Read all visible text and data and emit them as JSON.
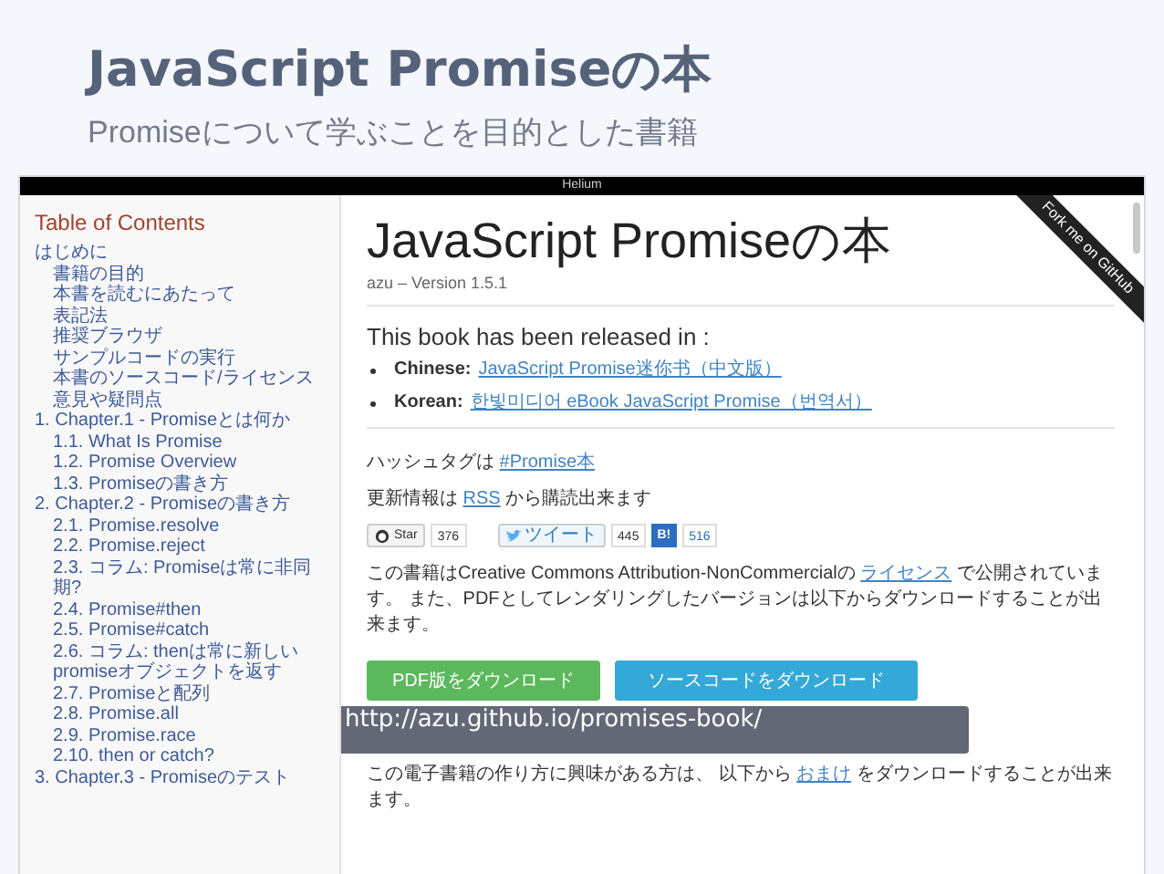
{
  "slide": {
    "title": "JavaScript Promiseの本",
    "subtitle": "Promiseについて学ぶことを目的とした書籍"
  },
  "browser": {
    "title": "Helium"
  },
  "toc": {
    "heading": "Table of Contents",
    "items": [
      {
        "label": "はじめに",
        "children": [
          {
            "label": "書籍の目的"
          },
          {
            "label": "本書を読むにあたって"
          },
          {
            "label": "表記法"
          },
          {
            "label": "推奨ブラウザ"
          },
          {
            "label": "サンプルコードの実行"
          },
          {
            "label": "本書のソースコード/ライセンス"
          },
          {
            "label": "意見や疑問点"
          }
        ]
      },
      {
        "label": "1. Chapter.1 - Promiseとは何か",
        "children": [
          {
            "label": "1.1. What Is Promise"
          },
          {
            "label": "1.2. Promise Overview"
          },
          {
            "label": "1.3. Promiseの書き方"
          }
        ]
      },
      {
        "label": "2. Chapter.2 - Promiseの書き方",
        "children": [
          {
            "label": "2.1. Promise.resolve"
          },
          {
            "label": "2.2. Promise.reject"
          },
          {
            "label": "2.3. コラム: Promiseは常に非同期?"
          },
          {
            "label": "2.4. Promise#then"
          },
          {
            "label": "2.5. Promise#catch"
          },
          {
            "label": "2.6. コラム: thenは常に新しいpromiseオブジェクトを返す"
          },
          {
            "label": "2.7. Promiseと配列"
          },
          {
            "label": "2.8. Promise.all"
          },
          {
            "label": "2.9. Promise.race"
          },
          {
            "label": "2.10. then or catch?"
          }
        ]
      },
      {
        "label": "3. Chapter.3 - Promiseのテスト"
      }
    ]
  },
  "page": {
    "title": "JavaScript Promiseの本",
    "byline": "azu – Version 1.5.1",
    "released": "This book has been released in :",
    "translations": [
      {
        "language": "Chinese",
        "separator": ":",
        "link": "JavaScript Promise迷你书（中文版）"
      },
      {
        "language": "Korean",
        "separator": ":",
        "link": "한빛미디어 eBook JavaScript Promise（번역서）"
      }
    ],
    "hashtag": {
      "before": "ハッシュタグは",
      "link": "#Promise本"
    },
    "rss": {
      "before": "更新情報は",
      "link": "RSS",
      "after": "から購読出来ます"
    },
    "social": [
      {
        "kind": "github",
        "label": "Star",
        "count": "376"
      },
      {
        "kind": "twitter",
        "label": "ツイート",
        "count": "445"
      },
      {
        "kind": "hatena",
        "label": "B!",
        "count": "516"
      }
    ],
    "license": {
      "before": "この書籍はCreative Commons Attribution-NonCommercialの",
      "link": "ライセンス",
      "after": "で公開されています。 また、PDFとしてレンダリングしたバージョンは以下からダウンロードすることが出来ます。"
    },
    "buttons": [
      {
        "kind": "pdf",
        "label": "PDF版をダウンロード"
      },
      {
        "kind": "source",
        "label": "ソースコードをダウンロード"
      }
    ],
    "extras": {
      "before": "この電子書籍の作り方に興味がある方は、 以下から",
      "link": "おまけ",
      "after": "をダウンロードすることが出来ます。"
    }
  },
  "ribbon": "Fork me on GitHub",
  "caption": "http://azu.github.io/promises-book/"
}
